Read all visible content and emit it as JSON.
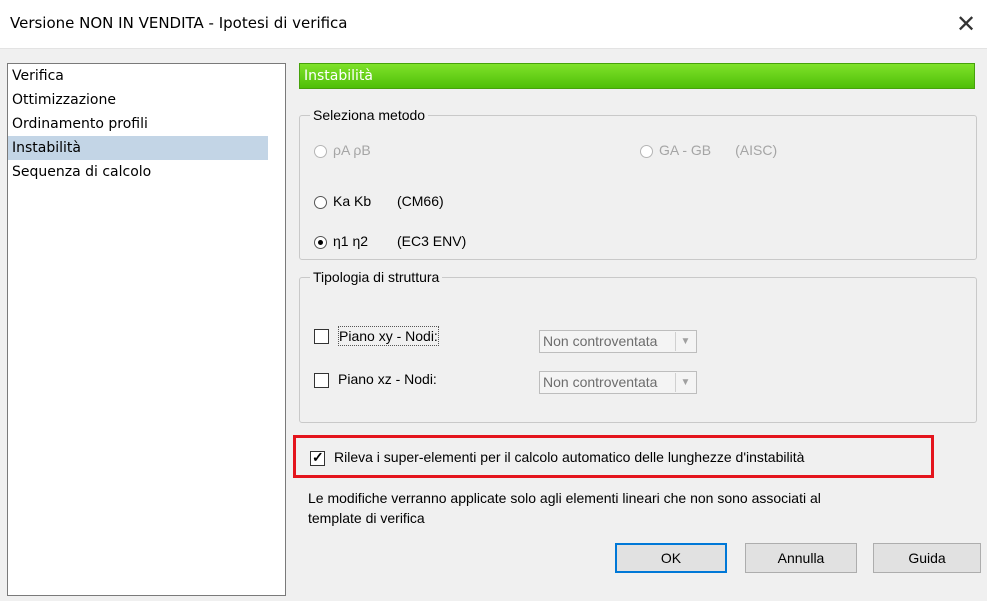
{
  "window": {
    "title": "Versione NON IN VENDITA - Ipotesi di verifica",
    "close_glyph": "✕"
  },
  "sidebar": {
    "items": [
      {
        "label": "Verifica",
        "active": false
      },
      {
        "label": "Ottimizzazione",
        "active": false
      },
      {
        "label": "Ordinamento profili",
        "active": false
      },
      {
        "label": "Instabilità",
        "active": true
      },
      {
        "label": "Sequenza di calcolo",
        "active": false
      }
    ]
  },
  "panel": {
    "header": "Instabilità",
    "method_group": {
      "legend": "Seleziona metodo",
      "options": [
        {
          "label": "ρA ρB",
          "note": "",
          "enabled": false,
          "selected": false
        },
        {
          "label": "GA - GB",
          "note": "(AISC)",
          "enabled": false,
          "selected": false
        },
        {
          "label": "Ka Kb",
          "note": "(CM66)",
          "enabled": true,
          "selected": false
        },
        {
          "label": "η1 η2",
          "note": "(EC3 ENV)",
          "enabled": true,
          "selected": true
        }
      ]
    },
    "structure_group": {
      "legend": "Tipologia di struttura",
      "rows": [
        {
          "label": "Piano xy - Nodi:",
          "checked": false,
          "combo": "Non controventata"
        },
        {
          "label": "Piano xz - Nodi:",
          "checked": false,
          "combo": "Non controventata"
        }
      ]
    },
    "super_elements": {
      "label": "Rileva i super-elementi per il calcolo automatico delle lunghezze d'instabilità",
      "checked": true
    },
    "note_line1": "Le modifiche verranno applicate solo agli elementi lineari che non sono associati al",
    "note_line2": "template di verifica"
  },
  "buttons": {
    "ok": "OK",
    "cancel": "Annulla",
    "help": "Guida"
  },
  "colors": {
    "header_green": "#5ccd12",
    "highlight_red": "#e4151d",
    "selection_blue": "#c3d5e6"
  },
  "icons": {
    "dropdown": "▼",
    "check": "✓"
  }
}
